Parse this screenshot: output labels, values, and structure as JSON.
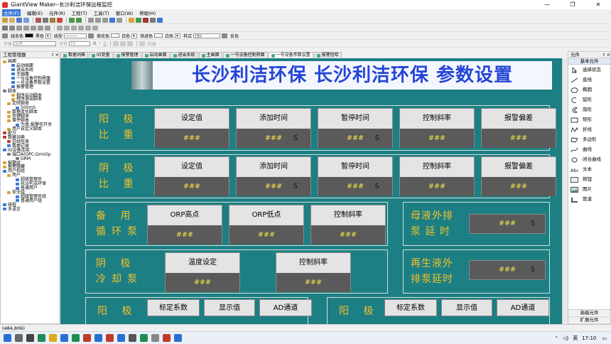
{
  "window": {
    "title": "GiantView Maker--长沙利洁环保远程监控",
    "controls": [
      "—",
      "❐",
      "✕"
    ]
  },
  "menu": [
    "文件(F)",
    "编辑(E)",
    "元件(R)",
    "工程(T)",
    "工具(T)",
    "窗口(W)",
    "帮助(H)"
  ],
  "format_bar": {
    "line_color_label": "线条色",
    "line_color_name": "黑色",
    "line_style_label": "线型",
    "fill_color_label": "填充色",
    "fill_color_name": "白色",
    "gradient_label": "渐进色",
    "gradient_name": "白色",
    "style_label": "样式",
    "style_value": "(无)",
    "reverse_label": "反色"
  },
  "font_bar": {
    "font_label": "字体",
    "font_value": "宋体",
    "size_label": "字号",
    "size_value": "16",
    "align_label": "内容"
  },
  "project_panel": {
    "title": "工程管理器",
    "pin": "♯ ×",
    "tree": [
      {
        "label": "画面",
        "level": 0,
        "color": "#d9a23a"
      },
      {
        "label": "启动画面",
        "level": 2,
        "color": "#3a78d8"
      },
      {
        "label": "进出系统",
        "level": 2,
        "color": "#3a78d8"
      },
      {
        "label": "主画面",
        "level": 2,
        "color": "#3a78d8"
      },
      {
        "label": "一号设备控制界面",
        "level": 2,
        "color": "#3a78d8"
      },
      {
        "label": "一号设备参数设置",
        "level": 2,
        "color": "#3a78d8"
      },
      {
        "label": "报警管理",
        "level": 2,
        "color": "#3a78d8"
      },
      {
        "label": "脚本",
        "level": 0,
        "color": "#777777"
      },
      {
        "label": "程序启动脚本",
        "level": 2,
        "color": "#d9a23a"
      },
      {
        "label": "程序退出脚本",
        "level": 2,
        "color": "#d9a23a"
      },
      {
        "label": "定时脚本",
        "level": 1,
        "color": "#d9a23a"
      },
      {
        "label": "500mS",
        "level": 3,
        "color": "#3a78d8"
      },
      {
        "label": "数据变化脚本",
        "level": 1,
        "color": "#d9a23a"
      },
      {
        "label": "热键脚本",
        "level": 1,
        "color": "#d9a23a"
      },
      {
        "label": "事件脚本",
        "level": 1,
        "color": "#d9a23a"
      },
      {
        "label": "为真:报警任开关",
        "level": 3,
        "color": "#3a78d8"
      },
      {
        "label": "用户自定义脚本",
        "level": 1,
        "color": "#d9a23a"
      },
      {
        "label": "配方",
        "level": 0,
        "color": "#c0392b"
      },
      {
        "label": "数据词典",
        "level": 0,
        "color": "#c0392b"
      },
      {
        "label": "驻线任表",
        "level": 1,
        "color": "#c0392b"
      },
      {
        "label": "数据记录",
        "level": 1,
        "color": "#3a78d8"
      },
      {
        "label": "IO设备连接",
        "level": 0,
        "color": "#3a78d8"
      },
      {
        "label": "端口A(OPC:GrmOp",
        "level": 1,
        "color": "#777777"
      },
      {
        "label": "GRM",
        "level": 3,
        "color": "#777777"
      },
      {
        "label": "报警组",
        "level": 0,
        "color": "#d9a23a"
      },
      {
        "label": "报警隐藏",
        "level": 0,
        "color": "#d9a23a"
      },
      {
        "label": "用户和组",
        "level": 0,
        "color": "#3a78d8"
      },
      {
        "label": "用户",
        "level": 1,
        "color": "#d9a23a"
      },
      {
        "label": "超级管理员",
        "level": 3,
        "color": "#3a78d8"
      },
      {
        "label": "长沙利洁环保",
        "level": 3,
        "color": "#3a78d8"
      },
      {
        "label": "普通用户",
        "level": 3,
        "color": "#3a78d8"
      },
      {
        "label": "安全组",
        "level": 1,
        "color": "#d9a23a"
      },
      {
        "label": "超级管理员组",
        "level": 3,
        "color": "#3a78d8"
      },
      {
        "label": "普通用户组",
        "level": 3,
        "color": "#3a78d8"
      },
      {
        "label": "排程",
        "level": 0,
        "color": "#3a78d8"
      },
      {
        "label": "多语言",
        "level": 0,
        "color": "#3a78d8"
      }
    ]
  },
  "tabs": [
    {
      "label": "数据词典",
      "active": false
    },
    {
      "label": "IO变量",
      "active": false
    },
    {
      "label": "报警管理",
      "active": false
    },
    {
      "label": "启动画面",
      "active": false
    },
    {
      "label": "进出系统",
      "active": false
    },
    {
      "label": "主画面",
      "active": false
    },
    {
      "label": "一号设备控制界面",
      "active": false
    },
    {
      "label": "一号设备参数设置",
      "active": true
    },
    {
      "label": "报警信哈",
      "active": false
    }
  ],
  "banner": {
    "text": "长沙利洁环保  长沙利洁环保  参数设置"
  },
  "section_row1": {
    "label_top": "阳 极",
    "label_bottom": "比 重",
    "boxes": [
      {
        "header": "设定值",
        "value": "###",
        "unit": ""
      },
      {
        "header": "添加时间",
        "value": "###",
        "unit": "S"
      },
      {
        "header": "暂停时间",
        "value": "###",
        "unit": "S"
      },
      {
        "header": "控制斜率",
        "value": "###",
        "unit": ""
      },
      {
        "header": "报警偏差",
        "value": "###",
        "unit": ""
      }
    ]
  },
  "section_row2": {
    "label_top": "阴 极",
    "label_bottom": "比 重",
    "boxes": [
      {
        "header": "设定值",
        "value": "###",
        "unit": ""
      },
      {
        "header": "添加时间",
        "value": "###",
        "unit": "S"
      },
      {
        "header": "暂停时间",
        "value": "###",
        "unit": "S"
      },
      {
        "header": "控制斜率",
        "value": "###",
        "unit": ""
      },
      {
        "header": "报警偏差",
        "value": "###",
        "unit": ""
      }
    ]
  },
  "section_row3": {
    "label_top": "备 用",
    "label_bottom": "循环泵",
    "boxes": [
      {
        "header": "ORP高点",
        "value": "###",
        "unit": ""
      },
      {
        "header": "ORP低点",
        "value": "###",
        "unit": ""
      },
      {
        "header": "控制斜率",
        "value": "###",
        "unit": ""
      }
    ]
  },
  "mother_pump": {
    "label_top": "母液外排",
    "label_bottom": "泵 延 时",
    "value": "###",
    "unit": "S"
  },
  "section_row4": {
    "label_top": "阴 极",
    "label_bottom": "冷却泵",
    "boxes": [
      {
        "header": "温度设定",
        "value": "###",
        "unit": ""
      },
      {
        "header": "控制斜率",
        "value": "###",
        "unit": ""
      }
    ]
  },
  "regen_pump": {
    "label_top": "再生液外",
    "label_bottom": "排泵延时",
    "value": "###",
    "unit": "S"
  },
  "section_row5_left": {
    "label": "阳 极",
    "headers": [
      "标定系数",
      "显示值",
      "AD通道"
    ]
  },
  "section_row5_right": {
    "label": "阳 极",
    "headers": [
      "标定系数",
      "显示值",
      "AD通道"
    ]
  },
  "elements_panel": {
    "title": "元件",
    "pin": "♯ ×",
    "tab_basic": "基本元件",
    "items": [
      {
        "label": "选择状态",
        "icon": "select-arrow-icon"
      },
      {
        "label": "直线",
        "icon": "line-icon"
      },
      {
        "label": "椭圆",
        "icon": "ellipse-icon"
      },
      {
        "label": "弧形",
        "icon": "arc-icon"
      },
      {
        "label": "扇形",
        "icon": "sector-icon"
      },
      {
        "label": "矩形",
        "icon": "rectangle-icon"
      },
      {
        "label": "折线",
        "icon": "polyline-icon"
      },
      {
        "label": "多边形",
        "icon": "polygon-icon"
      },
      {
        "label": "曲线",
        "icon": "curve-icon"
      },
      {
        "label": "闭合曲线",
        "icon": "closed-curve-icon"
      },
      {
        "label": "文本",
        "icon": "text-icon"
      },
      {
        "label": "按钮",
        "icon": "button-icon"
      },
      {
        "label": "图片",
        "icon": "image-icon"
      },
      {
        "label": "管道",
        "icon": "pipe-icon"
      }
    ],
    "tab_advanced": "高级元件",
    "tab_extended": "扩展元件"
  },
  "status_bar": {
    "coords": "(484,806)"
  },
  "taskbar": {
    "lang": "英",
    "time": "17:10"
  }
}
